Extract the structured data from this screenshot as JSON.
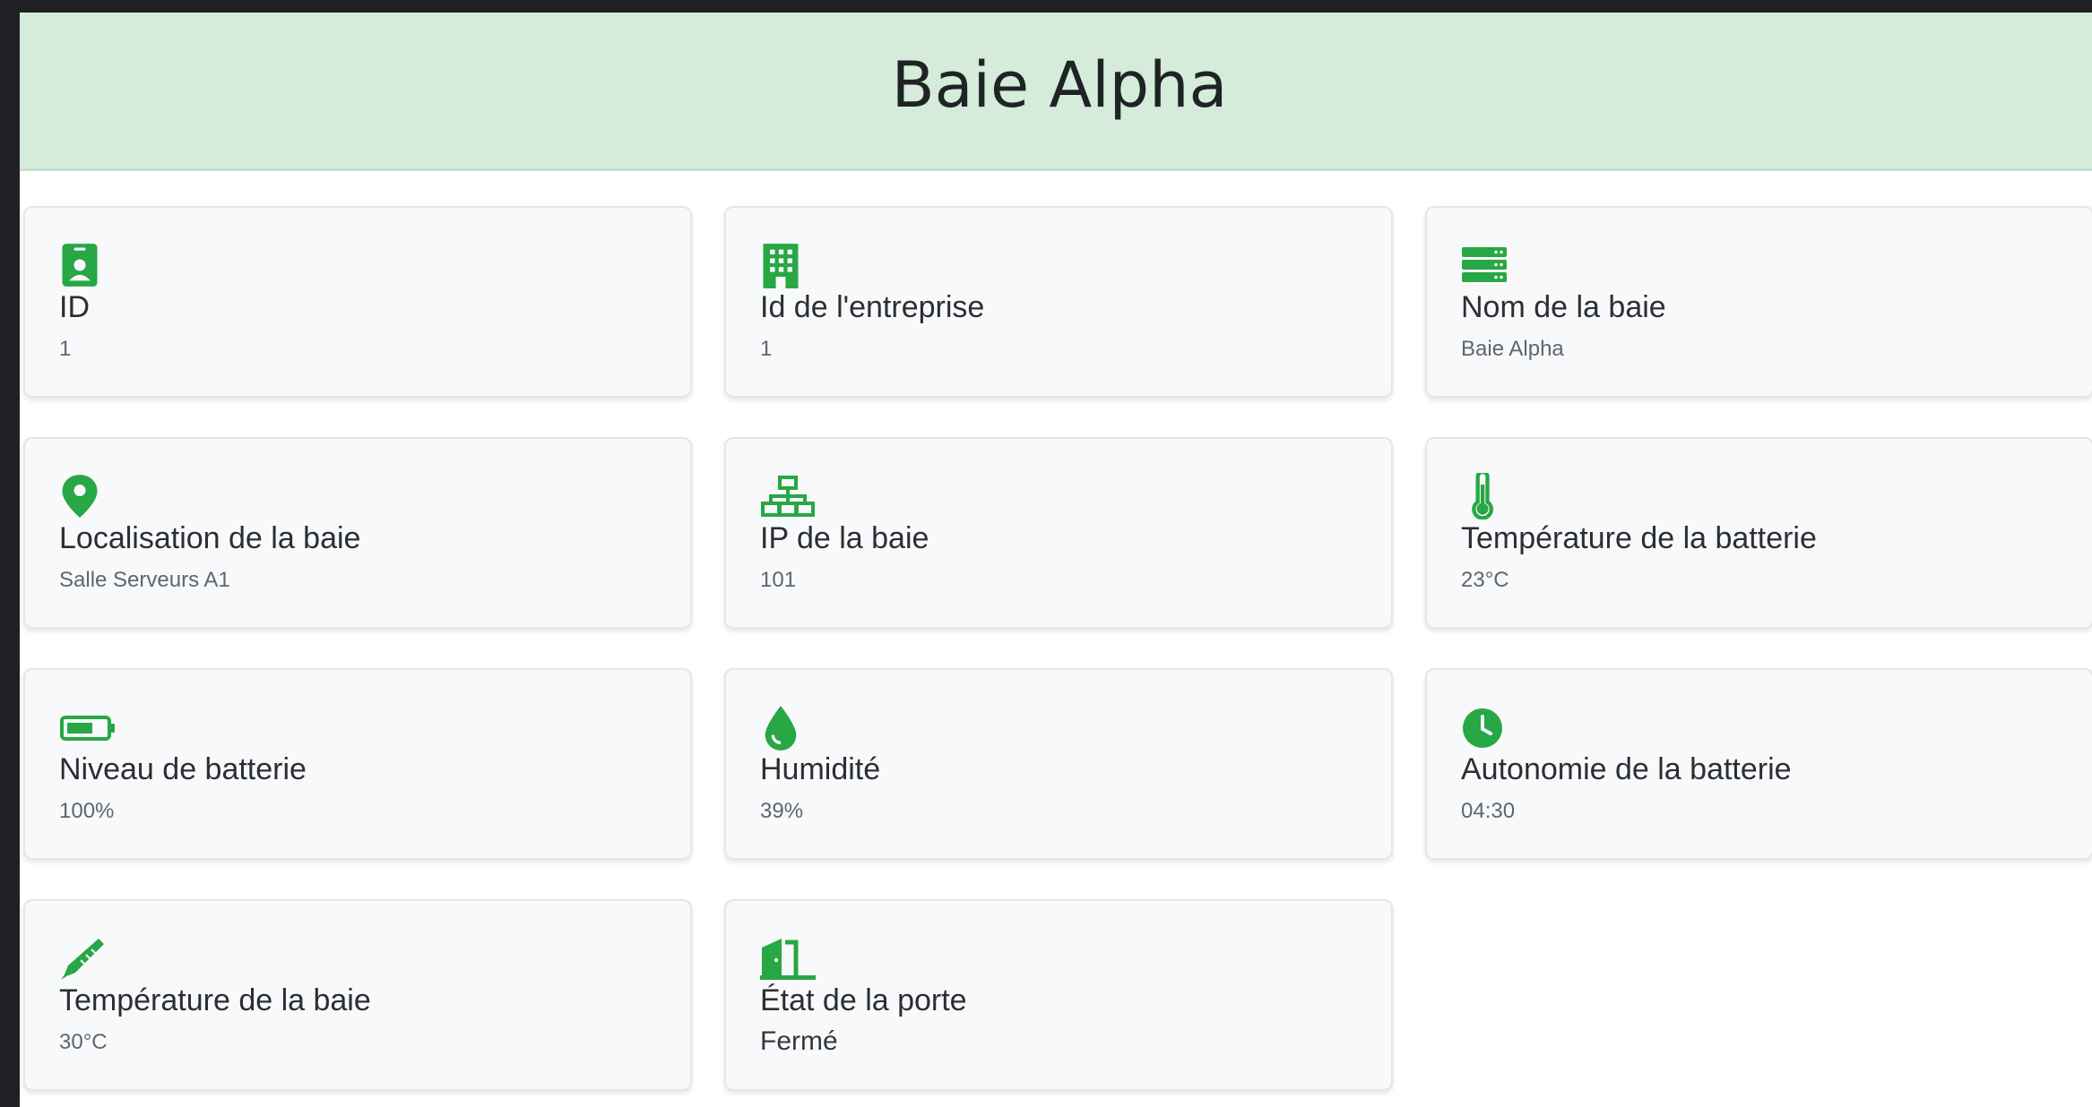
{
  "header": {
    "title": "Baie Alpha"
  },
  "theme": {
    "accent": "#28a745",
    "header_bg": "#d4ecd9"
  },
  "cards": [
    {
      "icon": "id-badge-icon",
      "label": "ID",
      "value": "1"
    },
    {
      "icon": "building-icon",
      "label": "Id de l'entreprise",
      "value": "1"
    },
    {
      "icon": "server-icon",
      "label": "Nom de la baie",
      "value": "Baie Alpha"
    },
    {
      "icon": "map-pin-icon",
      "label": "Localisation de la baie",
      "value": "Salle Serveurs A1"
    },
    {
      "icon": "network-icon",
      "label": "IP de la baie",
      "value": "101"
    },
    {
      "icon": "thermometer-icon",
      "label": "Température de la batterie",
      "value": "23°C"
    },
    {
      "icon": "battery-full-icon",
      "label": "Niveau de batterie",
      "value": "100%"
    },
    {
      "icon": "droplet-icon",
      "label": "Humidité",
      "value": "39%"
    },
    {
      "icon": "clock-icon",
      "label": "Autonomie de la batterie",
      "value": "04:30"
    },
    {
      "icon": "thermometer-pen-icon",
      "label": "Température de la baie",
      "value": "30°C"
    },
    {
      "icon": "door-icon",
      "label": "État de la porte",
      "value": "Fermé"
    }
  ]
}
